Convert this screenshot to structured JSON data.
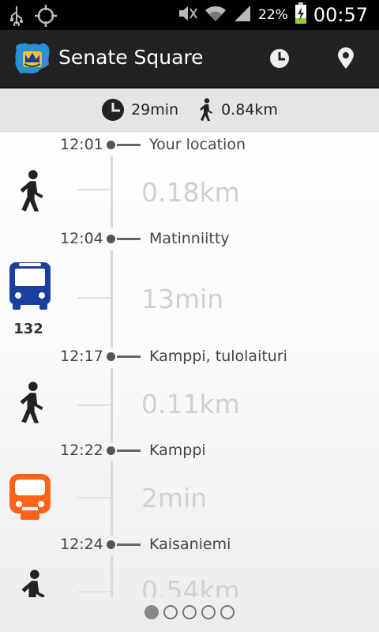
{
  "status_bar": {
    "battery_pct": "22%",
    "clock": "00:57"
  },
  "action_bar": {
    "title": "Senate Square"
  },
  "summary": {
    "duration": "29min",
    "distance": "0.84km"
  },
  "timeline": {
    "stops": [
      {
        "time": "12:01",
        "name": "Your location"
      },
      {
        "time": "12:04",
        "name": "Matinniitty"
      },
      {
        "time": "12:17",
        "name": "Kamppi, tulolaituri"
      },
      {
        "time": "12:22",
        "name": "Kamppi"
      },
      {
        "time": "12:24",
        "name": "Kaisaniemi"
      }
    ],
    "segments": [
      {
        "mode": "walk",
        "value": "0.18km"
      },
      {
        "mode": "bus",
        "value": "13min",
        "route": "132",
        "color": "#1b3fa0"
      },
      {
        "mode": "walk",
        "value": "0.11km"
      },
      {
        "mode": "metro",
        "value": "2min",
        "color": "#ff6319"
      },
      {
        "mode": "walk",
        "value": "0.54km"
      }
    ]
  },
  "pager": {
    "count": 5,
    "active": 0
  }
}
